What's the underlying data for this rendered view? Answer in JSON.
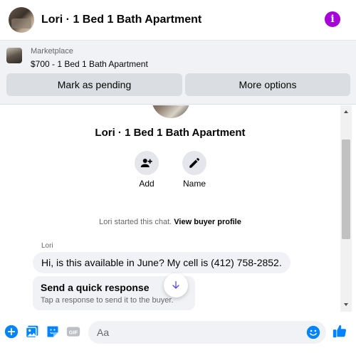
{
  "header": {
    "title": "Lori · 1 Bed 1 Bath Apartment"
  },
  "marketplace": {
    "label": "Marketplace",
    "listing": "$700 - 1 Bed 1 Bath Apartment",
    "buttons": {
      "pending": "Mark as pending",
      "more": "More options"
    }
  },
  "profile": {
    "title": "Lori · 1 Bed 1 Bath Apartment",
    "add_label": "Add",
    "name_label": "Name"
  },
  "chat": {
    "started_text": "Lori started this chat.",
    "view_profile": "View buyer profile",
    "sender": "Lori",
    "message": "Hi, is this available in June?  My cell is (412) 758-2852.",
    "quick_title": "Send a quick response",
    "quick_sub": "Tap a response to send it to the buyer."
  },
  "composer": {
    "placeholder": "Aa",
    "gif_label": "GIF"
  },
  "colors": {
    "accent": "#0084ff",
    "info": "#a700d9",
    "bubble": "#f0f2f5"
  },
  "icons": [
    "info-icon",
    "person-add-icon",
    "pencil-icon",
    "arrow-down-icon",
    "plus-icon",
    "image-icon",
    "sticker-icon",
    "gif-icon",
    "emoji-icon",
    "thumbs-up-icon"
  ]
}
